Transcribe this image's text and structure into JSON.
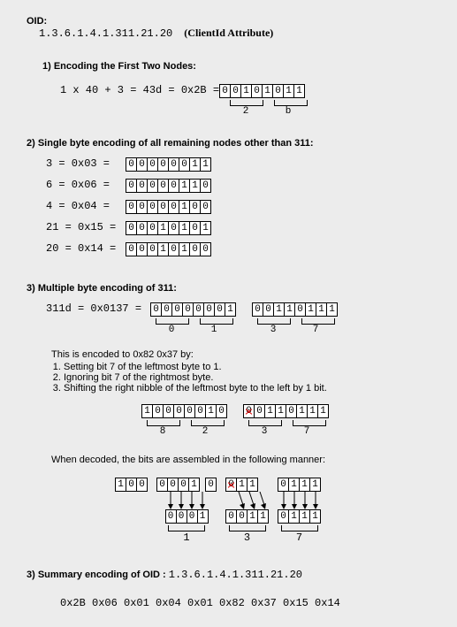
{
  "oid": {
    "label": "OID:",
    "value": "1.3.6.1.4.1.311.21.20",
    "attr": "(ClientId Attribute)"
  },
  "sec1": {
    "head": "1) Encoding the First Two Nodes:",
    "expr": "1 x 40 + 3 = 43d = 0x2B =",
    "bits": [
      "0",
      "0",
      "1",
      "0",
      "1",
      "0",
      "1",
      "1"
    ],
    "nibbles": [
      "2",
      "b"
    ]
  },
  "sec2": {
    "head": "2) Single byte encoding of all remaining nodes other than 311:",
    "rows": [
      {
        "expr": "3 = 0x03 =",
        "bits": [
          "0",
          "0",
          "0",
          "0",
          "0",
          "0",
          "1",
          "1"
        ]
      },
      {
        "expr": "6 = 0x06 =",
        "bits": [
          "0",
          "0",
          "0",
          "0",
          "0",
          "1",
          "1",
          "0"
        ]
      },
      {
        "expr": "4 = 0x04 =",
        "bits": [
          "0",
          "0",
          "0",
          "0",
          "0",
          "1",
          "0",
          "0"
        ]
      },
      {
        "expr": "21 = 0x15 =",
        "bits": [
          "0",
          "0",
          "0",
          "1",
          "0",
          "1",
          "0",
          "1"
        ]
      },
      {
        "expr": "20 = 0x14 =",
        "bits": [
          "0",
          "0",
          "0",
          "1",
          "0",
          "1",
          "0",
          "0"
        ]
      }
    ]
  },
  "sec3": {
    "head": "3) Multiple byte encoding of 311:",
    "expr": "311d = 0x0137 =",
    "byteA": [
      "0",
      "0",
      "0",
      "0",
      "0",
      "0",
      "0",
      "1"
    ],
    "byteB": [
      "0",
      "0",
      "1",
      "1",
      "0",
      "1",
      "1",
      "1"
    ],
    "nibA": [
      "0",
      "1"
    ],
    "nibB": [
      "3",
      "7"
    ],
    "note_head": "This is encoded to 0x82 0x37 by:",
    "note1": "Setting bit 7 of the leftmost byte to 1.",
    "note2": "Ignoring bit 7 of the rightmost byte.",
    "note3": "Shifting the right nibble of the leftmost byte to the left by 1 bit.",
    "encA": [
      "1",
      "0",
      "0",
      "0",
      "0",
      "0",
      "1",
      "0"
    ],
    "encB": [
      "0",
      "0",
      "1",
      "1",
      "0",
      "1",
      "1",
      "1"
    ],
    "encNibA": [
      "8",
      "2"
    ],
    "encNibB": [
      "3",
      "7"
    ],
    "decode_text": "When decoded, the bits are assembled in the following manner:",
    "decTop1": [
      "1",
      "0",
      "0"
    ],
    "decTop2": [
      "0",
      "0",
      "0",
      "1"
    ],
    "decTop2b": [
      "0"
    ],
    "decTop3": [
      "0",
      "1",
      "1"
    ],
    "decTop4": [
      "0",
      "1",
      "1",
      "1"
    ],
    "decBot2": [
      "0",
      "0",
      "0",
      "1"
    ],
    "decBot3": [
      "0",
      "0",
      "1",
      "1"
    ],
    "decBot4": [
      "0",
      "1",
      "1",
      "1"
    ],
    "decNib": [
      "1",
      "3",
      "7"
    ]
  },
  "sec4": {
    "head": "3) Summary encoding of OID :",
    "oid": "1.3.6.1.4.1.311.21.20",
    "bytes": "0x2B  0x06  0x01  0x04  0x01  0x82  0x37  0x15  0x14"
  }
}
